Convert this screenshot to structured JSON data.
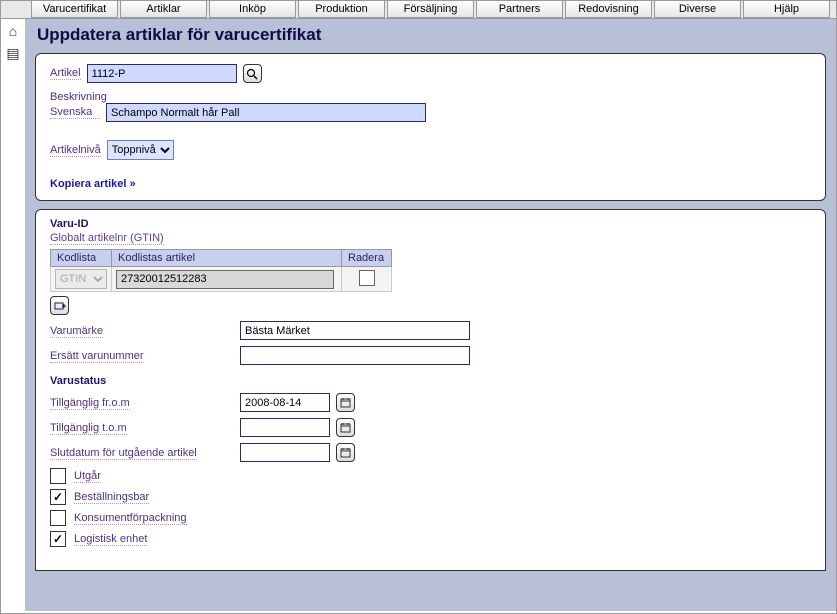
{
  "menu": [
    "Varucertifikat",
    "Artiklar",
    "Inköp",
    "Produktion",
    "Försäljning",
    "Partners",
    "Redovisning",
    "Diverse",
    "Hjälp"
  ],
  "page": {
    "title": "Uppdatera artiklar för varucertifikat"
  },
  "card1": {
    "artikel_label": "Artikel",
    "artikel_value": "1112-P",
    "beskrivning_label": "Beskrivning",
    "svenska_label": "Svenska",
    "svenska_value": "Schampo Normalt hår Pall",
    "artikelniva_label": "Artikelnivå",
    "artikelniva_value": "Toppnivå",
    "kopiera_link": "Kopiera artikel »"
  },
  "card2": {
    "varuid_title": "Varu-ID",
    "gtin_label": "Globalt artikelnr (GTIN)",
    "kodlista_h": "Kodlista",
    "kodartikel_h": "Kodlistas artikel",
    "radera_h": "Radera",
    "kodlista_value": "GTIN",
    "kodartikel_value": "27320012512283",
    "varumarke_label": "Varumärke",
    "varumarke_value": "Bästa Märket",
    "ersatt_label": "Ersätt varunummer",
    "ersatt_value": "",
    "varustatus_title": "Varustatus",
    "tillg_from_label": "Tillgänglig fr.o.m",
    "tillg_from_value": "2008-08-14",
    "tillg_tom_label": "Tillgänglig t.o.m",
    "tillg_tom_value": "",
    "slutdatum_label": "Slutdatum för utgående artikel",
    "slutdatum_value": "",
    "chk_utgar": "Utgår",
    "chk_bestall": "Beställningsbar",
    "chk_konsument": "Konsumentförpackning",
    "chk_logistik": "Logistisk enhet",
    "chk_utgar_val": false,
    "chk_bestall_val": true,
    "chk_konsument_val": false,
    "chk_logistik_val": true
  }
}
